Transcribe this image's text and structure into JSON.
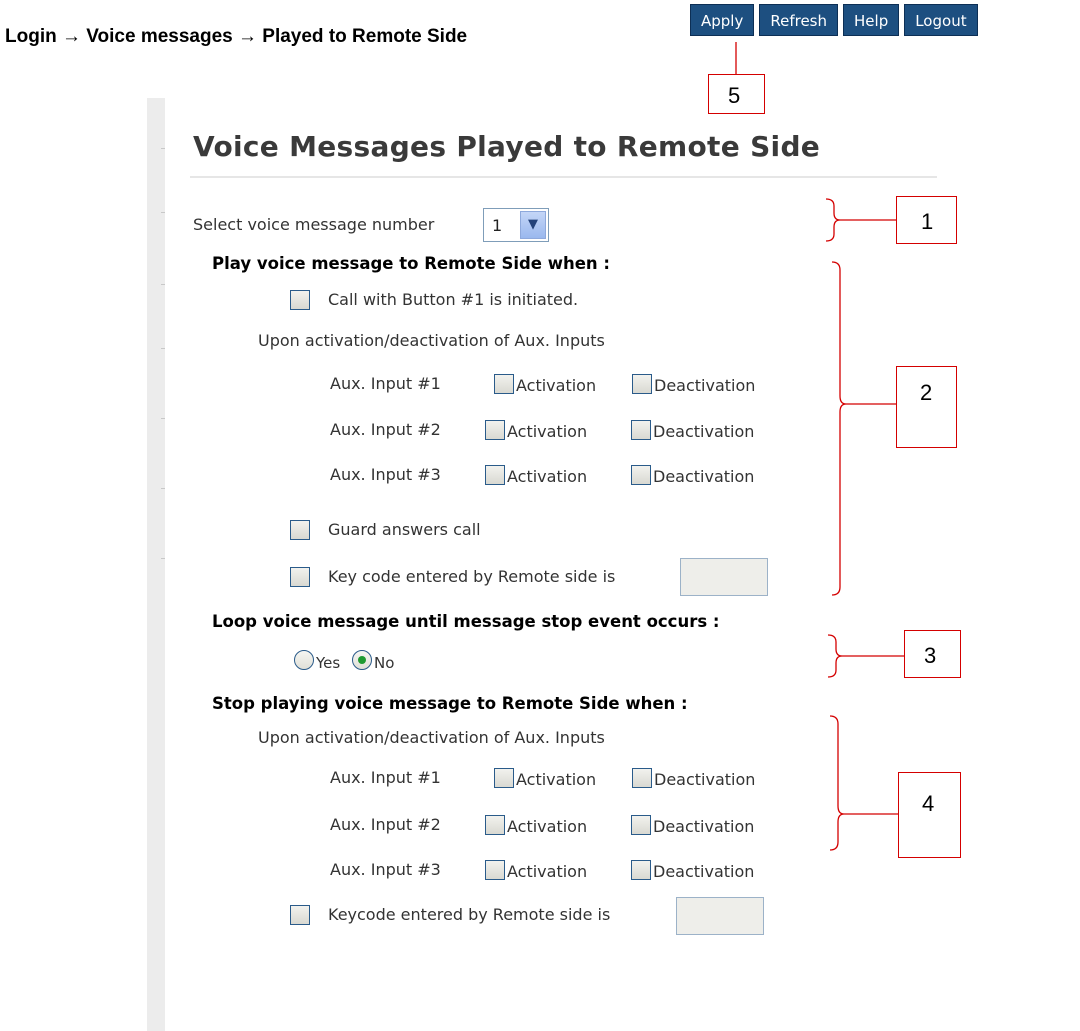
{
  "breadcrumb": "Login → Voice messages → Played to Remote Side",
  "toolbar": {
    "apply": "Apply",
    "refresh": "Refresh",
    "help": "Help",
    "logout": "Logout"
  },
  "page_title": "Voice Messages Played to Remote Side",
  "select": {
    "label": "Select voice message number",
    "value": "1"
  },
  "play_section": {
    "heading": "Play voice message to Remote Side when :",
    "call_button": "Call with Button #1 is initiated.",
    "aux_heading": "Upon activation/deactivation of Aux. Inputs",
    "aux": [
      {
        "label": "Aux. Input #1",
        "activation": "Activation",
        "deactivation": "Deactivation"
      },
      {
        "label": "Aux. Input #2",
        "activation": "Activation",
        "deactivation": "Deactivation"
      },
      {
        "label": "Aux. Input #3",
        "activation": "Activation",
        "deactivation": "Deactivation"
      }
    ],
    "guard": "Guard answers call",
    "keycode": "Key code entered by Remote side is"
  },
  "loop_section": {
    "heading": "Loop voice message until message stop event occurs :",
    "yes": "Yes",
    "no": "No",
    "selected": "No"
  },
  "stop_section": {
    "heading": "Stop playing voice message to Remote Side when :",
    "aux_heading": "Upon activation/deactivation of Aux. Inputs",
    "aux": [
      {
        "label": "Aux. Input #1",
        "activation": "Activation",
        "deactivation": "Deactivation"
      },
      {
        "label": "Aux. Input #2",
        "activation": "Activation",
        "deactivation": "Deactivation"
      },
      {
        "label": "Aux. Input #3",
        "activation": "Activation",
        "deactivation": "Deactivation"
      }
    ],
    "keycode": "Keycode entered by Remote side is"
  },
  "callouts": [
    "1",
    "2",
    "3",
    "4",
    "5"
  ],
  "colors": {
    "toolbar_bg": "#1d4f80",
    "callout": "#d40000",
    "radio_selected": "#1f9a32"
  }
}
